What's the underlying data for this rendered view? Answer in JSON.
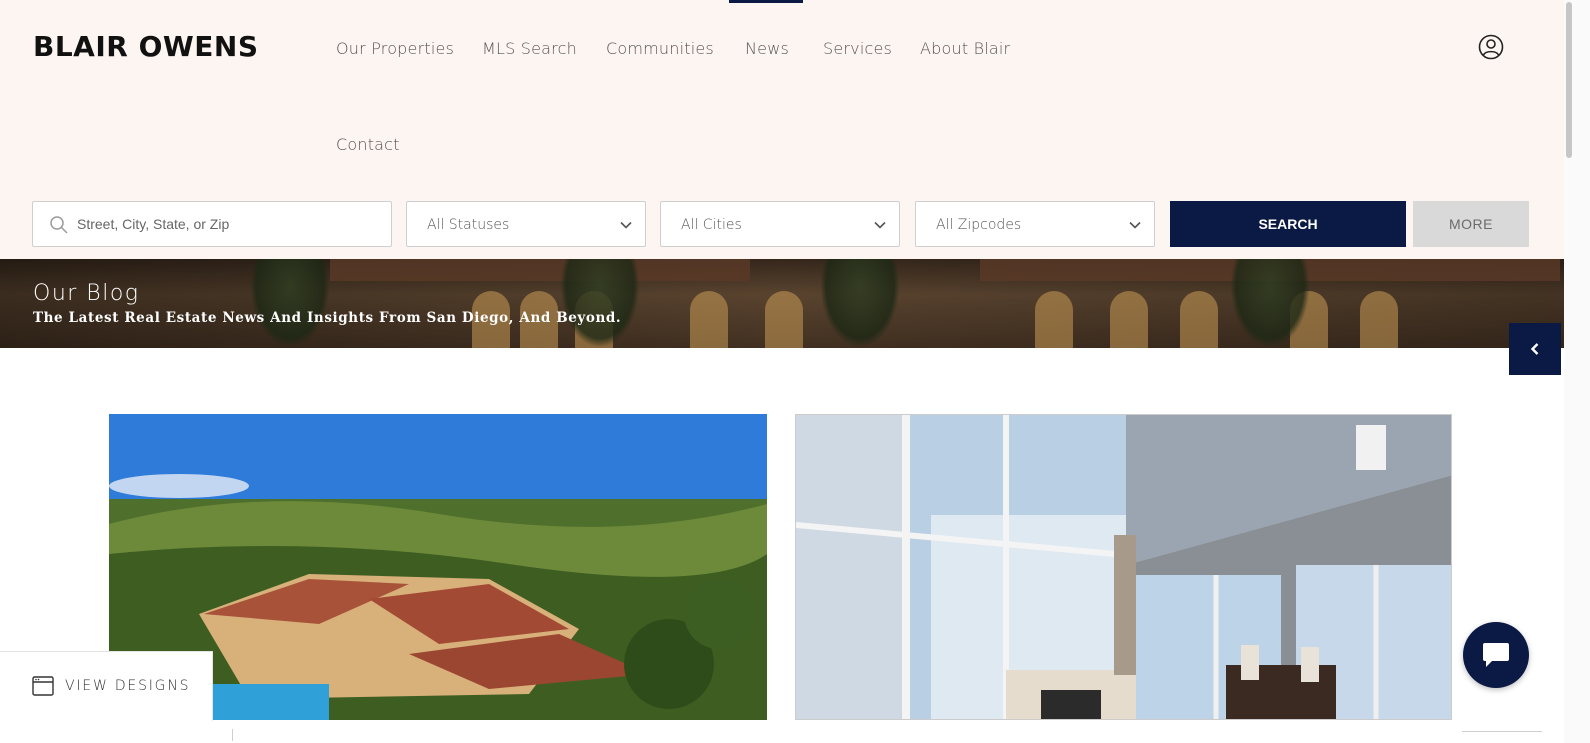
{
  "brand": {
    "name": "BLAIR OWENS"
  },
  "nav": {
    "items": [
      {
        "label": "Our Properties"
      },
      {
        "label": "MLS Search"
      },
      {
        "label": "Communities"
      },
      {
        "label": "News"
      },
      {
        "label": "Services"
      },
      {
        "label": "About Blair"
      },
      {
        "label": "Contact"
      }
    ],
    "active": "News",
    "user_icon": "user-circle-icon"
  },
  "search": {
    "placeholder": "Street, City, State, or Zip",
    "value": "",
    "filters": [
      {
        "selected": "All Statuses"
      },
      {
        "selected": "All Cities"
      },
      {
        "selected": "All Zipcodes"
      }
    ],
    "search_label": "SEARCH",
    "more_label": "MORE"
  },
  "hero": {
    "title": "Our Blog",
    "subtitle": "The Latest Real Estate News And Insights From San Diego, And Beyond."
  },
  "widgets": {
    "view_designs_label": "VIEW DESIGNS",
    "side_tab_icon": "chevron-left-icon",
    "chat_icon": "chat-bubble-icon"
  },
  "colors": {
    "header_bg": "#fdf5f1",
    "accent": "#0b1a45",
    "more_bg": "#d9d9d9"
  }
}
